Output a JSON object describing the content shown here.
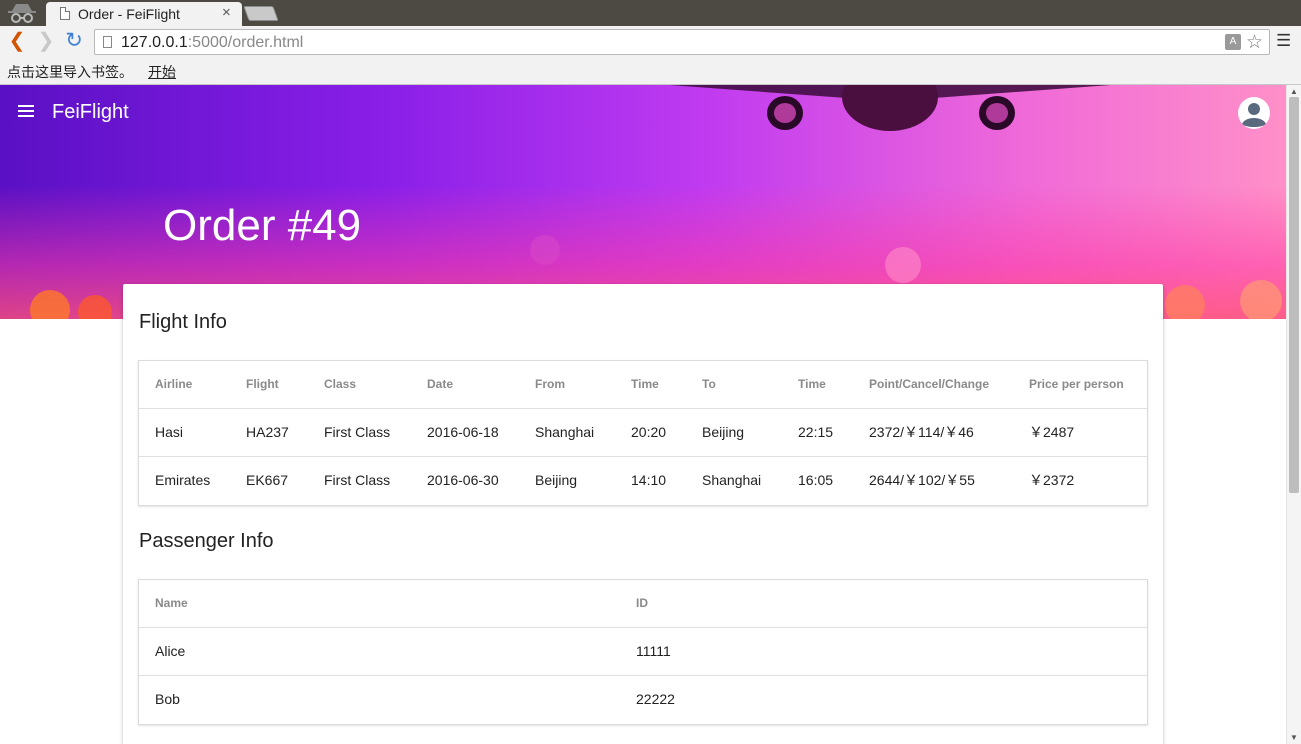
{
  "browser": {
    "tab_title": "Order - FeiFlight",
    "tab_close": "×",
    "url_host": "127.0.0.1",
    "url_rest": ":5000/order.html",
    "bookmarks_text": "点击这里导入书签。",
    "bookmarks_link": "开始"
  },
  "app": {
    "title": "FeiFlight",
    "page_heading": "Order #49"
  },
  "flight_info": {
    "title": "Flight Info",
    "columns": [
      "Airline",
      "Flight",
      "Class",
      "Date",
      "From",
      "Time",
      "To",
      "Time",
      "Point/Cancel/Change",
      "Price per person"
    ],
    "rows": [
      [
        "Hasi",
        "HA237",
        "First Class",
        "2016-06-18",
        "Shanghai",
        "20:20",
        "Beijing",
        "22:15",
        "2372/￥114/￥46",
        "￥2487"
      ],
      [
        "Emirates",
        "EK667",
        "First Class",
        "2016-06-30",
        "Beijing",
        "14:10",
        "Shanghai",
        "16:05",
        "2644/￥102/￥55",
        "￥2372"
      ]
    ]
  },
  "passenger_info": {
    "title": "Passenger Info",
    "columns": [
      "Name",
      "ID"
    ],
    "rows": [
      [
        "Alice",
        "11111"
      ],
      [
        "Bob",
        "22222"
      ]
    ]
  },
  "colors": {
    "hero_start": "#5a10c4",
    "hero_end": "#ff90c8",
    "header_text": "#8a8a8a"
  }
}
